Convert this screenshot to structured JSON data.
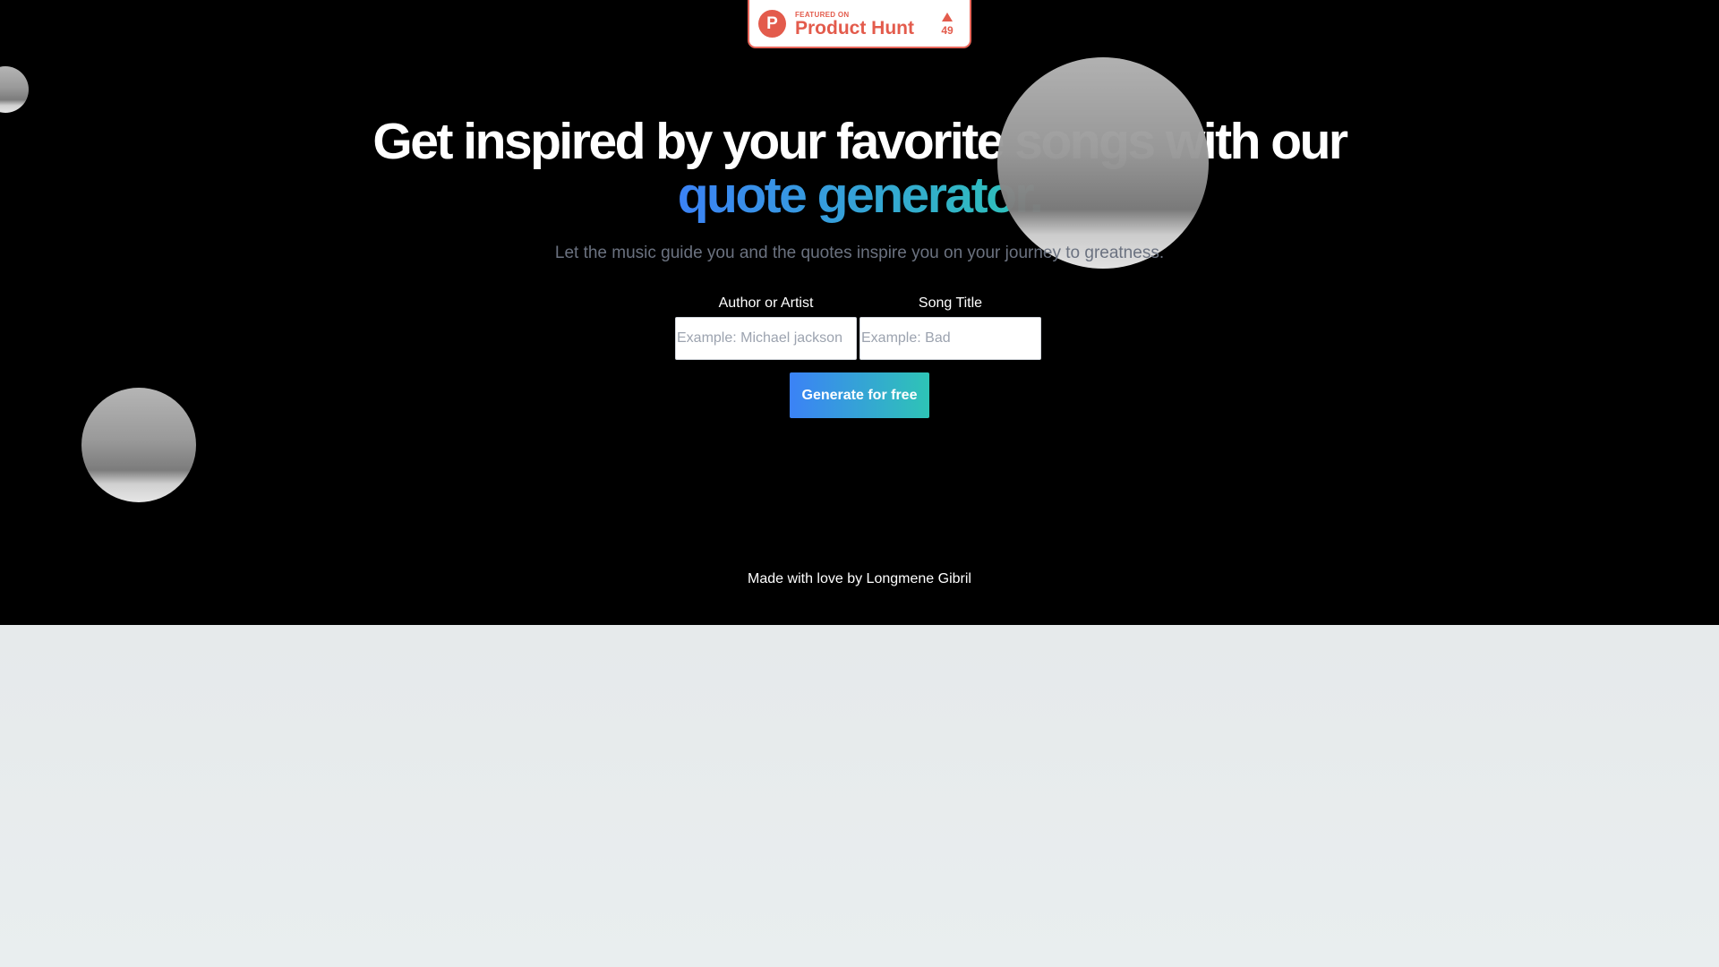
{
  "badge": {
    "logo_letter": "P",
    "featured_text": "FEATURED ON",
    "name": "Product Hunt",
    "votes": "49",
    "accent_color": "#e35b4c"
  },
  "hero": {
    "headline_line1": "Get inspired by your favorite songs with our",
    "headline_accent": "quote generator.",
    "subtitle": "Let the music guide you and the quotes inspire you on your journey to greatness.",
    "accent_gradient": [
      "#3b82f6",
      "#2ec4b6"
    ],
    "background": "#000000"
  },
  "form": {
    "author_label": "Author or Artist",
    "author_placeholder": "Example: Michael jackson",
    "author_value": "",
    "song_label": "Song Title",
    "song_placeholder": "Example: Bad",
    "song_value": "",
    "submit_label": "Generate for free"
  },
  "footer": {
    "credit": "Made with love by Longmene Gibril"
  }
}
